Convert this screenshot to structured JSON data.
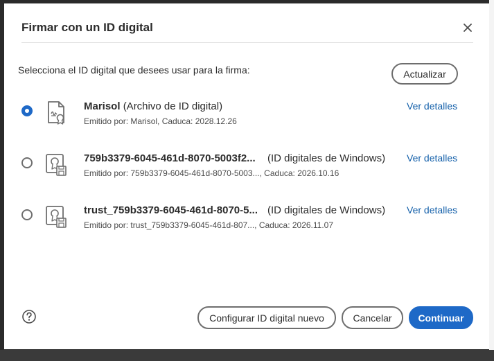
{
  "dialog": {
    "title": "Firmar con un ID digital",
    "instruction": "Selecciona el ID digital que desees usar para la firma:",
    "refresh_label": "Actualizar",
    "close_icon": "close-icon",
    "help_icon": "help-icon"
  },
  "ids": [
    {
      "selected": true,
      "icon": "certificate-file-icon",
      "name": "Marisol",
      "source": "(Archivo de ID digital)",
      "meta": "Emitido por: Marisol, Caduca: 2028.12.26",
      "details_label": "Ver detalles"
    },
    {
      "selected": false,
      "icon": "certificate-store-icon",
      "name": "759b3379-6045-461d-8070-5003f2...",
      "source": "(ID digitales de Windows)",
      "meta": "Emitido por: 759b3379-6045-461d-8070-5003..., Caduca: 2026.10.16",
      "details_label": "Ver detalles"
    },
    {
      "selected": false,
      "icon": "certificate-store-icon",
      "name": "trust_759b3379-6045-461d-8070-5...",
      "source": "(ID digitales de Windows)",
      "meta": "Emitido por: trust_759b3379-6045-461d-807..., Caduca: 2026.11.07",
      "details_label": "Ver detalles"
    }
  ],
  "footer": {
    "configure_label": "Configurar ID digital nuevo",
    "cancel_label": "Cancelar",
    "continue_label": "Continuar"
  },
  "colors": {
    "accent": "#1e69c7",
    "link": "#1460aa",
    "text": "#2c2c2c"
  }
}
